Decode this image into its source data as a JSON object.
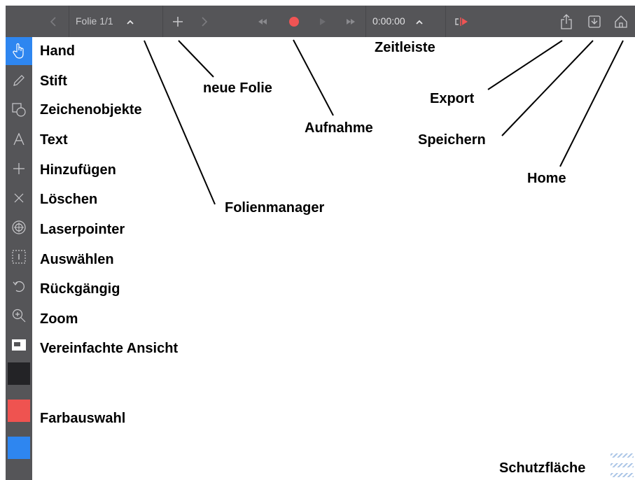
{
  "toolbar": {
    "slide_label": "Folie 1/1",
    "time": "0:00:00",
    "prev_icon": "chevron-left-icon",
    "next_icon": "chevron-right-icon",
    "add_icon": "plus-icon",
    "record_color": "#f05454",
    "icons": [
      "rewind-icon",
      "record-icon",
      "play-icon",
      "fast-forward-icon",
      "timeline-icon",
      "share-icon",
      "save-icon",
      "home-icon"
    ]
  },
  "sidebar": {
    "active_color": "#2e86f0",
    "tools": [
      {
        "icon": "hand-icon",
        "label": "Hand"
      },
      {
        "icon": "pencil-icon",
        "label": "Stift"
      },
      {
        "icon": "shapes-icon",
        "label": "Zeichenobjekte"
      },
      {
        "icon": "text-icon",
        "label": "Text"
      },
      {
        "icon": "plus-icon",
        "label": "Hinzufügen"
      },
      {
        "icon": "close-icon",
        "label": "Löschen"
      },
      {
        "icon": "crosshair-icon",
        "label": "Laserpointer"
      },
      {
        "icon": "selection-icon",
        "label": "Auswählen"
      },
      {
        "icon": "undo-icon",
        "label": "Rückgängig"
      },
      {
        "icon": "zoom-icon",
        "label": "Zoom"
      },
      {
        "icon": "simplified-view-icon",
        "label": "Vereinfachte Ansicht"
      }
    ],
    "swatches": [
      "#232326",
      "#ef5350",
      "#2e86f0"
    ],
    "color_label": "Farbauswahl"
  },
  "annotations": {
    "folienmanager": "Folienmanager",
    "neue_folie": "neue Folie",
    "aufnahme": "Aufnahme",
    "zeitleiste": "Zeitleiste",
    "export": "Export",
    "speichern": "Speichern",
    "home": "Home",
    "schutzflaeche": "Schutzfläche"
  }
}
